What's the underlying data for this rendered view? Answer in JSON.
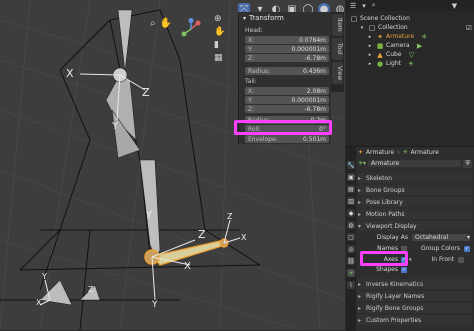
{
  "npanel": {
    "header": "Transform",
    "head_label": "Head:",
    "tail_label": "Tail:",
    "head": [
      {
        "k": "X:",
        "v": "0.0784m"
      },
      {
        "k": "Y:",
        "v": "0.000001m"
      },
      {
        "k": "Z:",
        "v": "-6.78m"
      }
    ],
    "head_radius": {
      "k": "Radius:",
      "v": "0.436m"
    },
    "tail": [
      {
        "k": "X:",
        "v": "2.08m"
      },
      {
        "k": "Y:",
        "v": "0.000001m"
      },
      {
        "k": "Z:",
        "v": "-6.78m"
      }
    ],
    "tail_radius": {
      "k": "Radius:",
      "v": "0.2m"
    },
    "roll": {
      "k": "Roll:",
      "v": "0°"
    },
    "envelope": {
      "k": "Envelope:",
      "v": "0.501m"
    },
    "tabs": [
      "Item",
      "Tool",
      "View"
    ]
  },
  "viewport_labels": {
    "x1": "X",
    "z1": "Z",
    "y1": "Y",
    "y2": "Y",
    "z2": "Z",
    "x2": "X",
    "z3": "Z",
    "y3": "Y",
    "x3": "X",
    "y4": "Y",
    "x4": "X",
    "z4": "Z"
  },
  "outliner": {
    "rows": [
      {
        "label": "Scene Collection",
        "depth": 0,
        "icon": "▢",
        "color": "#cfcfcf"
      },
      {
        "label": "Collection",
        "depth": 1,
        "icon": "▢",
        "color": "#e0e0e0"
      },
      {
        "label": "Armature",
        "depth": 2,
        "icon": "✦",
        "color": "#e8a23a"
      },
      {
        "label": "Camera",
        "depth": 2,
        "icon": "■",
        "color": "#7cb342"
      },
      {
        "label": "Cube",
        "depth": 2,
        "icon": "▲",
        "color": "#e8a23a"
      },
      {
        "label": "Light",
        "depth": 2,
        "icon": "●",
        "color": "#7cb342"
      }
    ]
  },
  "props": {
    "breadcrumb_left": "Armature",
    "breadcrumb_right": "Armature",
    "datablock_name": "Armature",
    "sections": [
      "Skeleton",
      "Bone Groups",
      "Pose Library",
      "Motion Paths"
    ],
    "viewport_display": "Viewport Display",
    "display_as_label": "Display As",
    "display_as_value": "Octahedral",
    "names_label": "Names",
    "group_colors_label": "Group Colors",
    "axes_label": "Axes",
    "in_front_label": "In Front",
    "shapes_label": "Shapes",
    "sections_bottom": [
      "Inverse Kinematics",
      "Rigify Layer Names",
      "Rigify Bone Groups",
      "Custom Properties"
    ]
  },
  "colors": {
    "highlight": "#ff40ff",
    "accent": "#4a78c8",
    "active_bone": "#f0a030"
  }
}
